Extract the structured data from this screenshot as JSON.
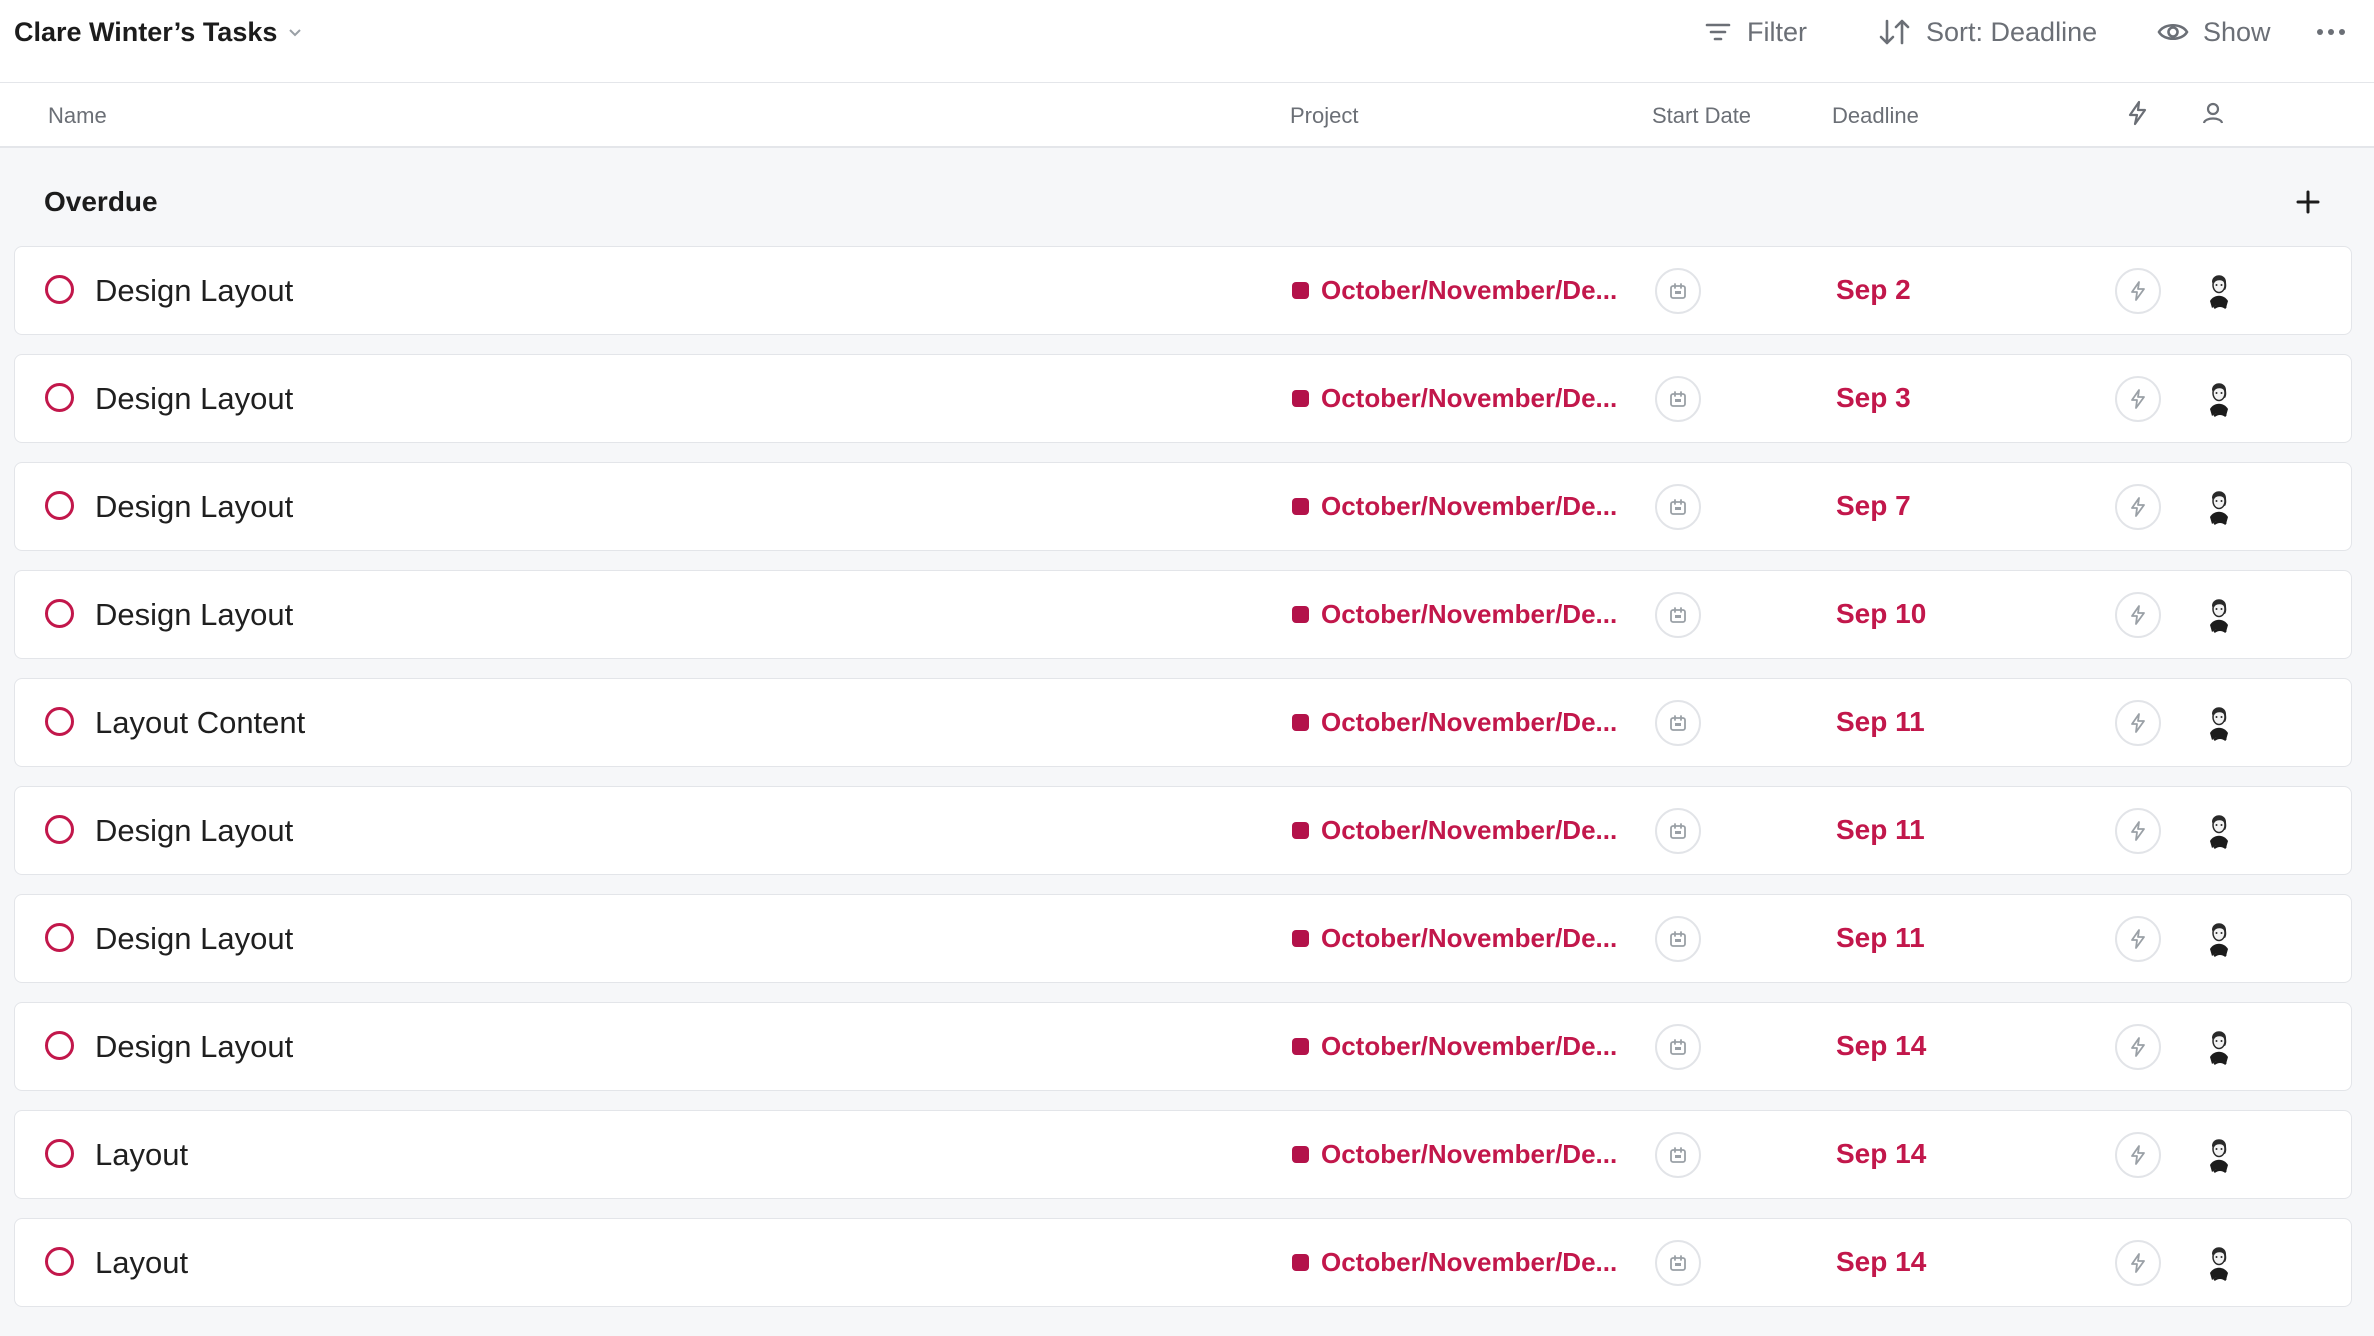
{
  "header": {
    "title": "Clare Winter’s Tasks",
    "filter_label": "Filter",
    "sort_label": "Sort: Deadline",
    "show_label": "Show"
  },
  "columns": {
    "name": "Name",
    "project": "Project",
    "start_date": "Start Date",
    "deadline": "Deadline"
  },
  "section": {
    "title": "Overdue"
  },
  "colors": {
    "accent": "#c2174b",
    "project_dot": "#b3124a"
  },
  "tasks": [
    {
      "name": "Design Layout",
      "project": "October/November/De...",
      "deadline": "Sep 2"
    },
    {
      "name": "Design Layout",
      "project": "October/November/De...",
      "deadline": "Sep 3"
    },
    {
      "name": "Design Layout",
      "project": "October/November/De...",
      "deadline": "Sep 7"
    },
    {
      "name": "Design Layout",
      "project": "October/November/De...",
      "deadline": "Sep 10"
    },
    {
      "name": "Layout Content",
      "project": "October/November/De...",
      "deadline": "Sep 11"
    },
    {
      "name": "Design Layout",
      "project": "October/November/De...",
      "deadline": "Sep 11"
    },
    {
      "name": "Design Layout",
      "project": "October/November/De...",
      "deadline": "Sep 11"
    },
    {
      "name": "Design Layout",
      "project": "October/November/De...",
      "deadline": "Sep 14"
    },
    {
      "name": "Layout",
      "project": "October/November/De...",
      "deadline": "Sep 14"
    },
    {
      "name": "Layout",
      "project": "October/November/De...",
      "deadline": "Sep 14"
    }
  ]
}
